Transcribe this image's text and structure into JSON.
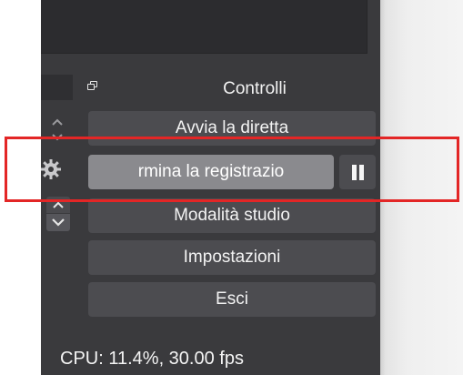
{
  "dock": {
    "title": "Controlli",
    "buttons": {
      "start_stream": "Avvia la diretta",
      "stop_recording": "rmina la registrazio",
      "studio_mode": "Modalità studio",
      "settings": "Impostazioni",
      "exit": "Esci"
    },
    "pause_icon": "pause-icon"
  },
  "status_bar": {
    "cpu_fps": "CPU: 11.4%, 30.00 fps"
  },
  "annotation": {
    "color": "#e32626"
  }
}
